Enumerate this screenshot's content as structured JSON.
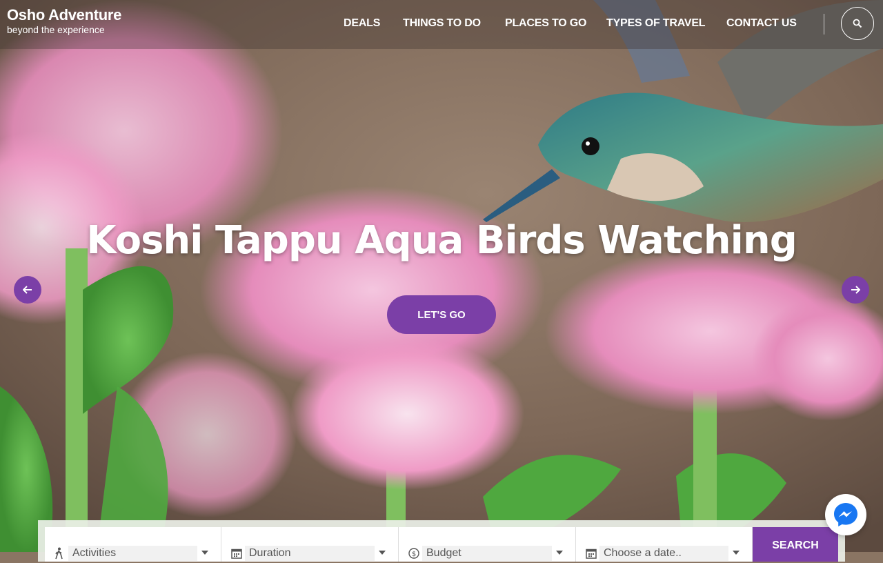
{
  "brand": {
    "name": "Osho Adventure",
    "tagline": "beyond the experience"
  },
  "nav": {
    "items": [
      {
        "label": "DEALS"
      },
      {
        "label": "THINGS TO DO"
      },
      {
        "label": "PLACES TO GO"
      },
      {
        "label": "TYPES OF TRAVEL"
      },
      {
        "label": "CONTACT US"
      }
    ],
    "search_icon": "search-icon"
  },
  "hero": {
    "title": "Koshi Tappu Aqua Birds Watching",
    "cta_label": "LET'S GO",
    "prev_icon": "arrow-left-icon",
    "next_icon": "arrow-right-icon"
  },
  "search_form": {
    "activities": "Activities",
    "duration": "Duration",
    "budget": "Budget",
    "date_placeholder": "Choose a date..",
    "submit_label": "SEARCH"
  },
  "colors": {
    "accent": "#7b3fa7",
    "text_light": "#ffffff"
  }
}
